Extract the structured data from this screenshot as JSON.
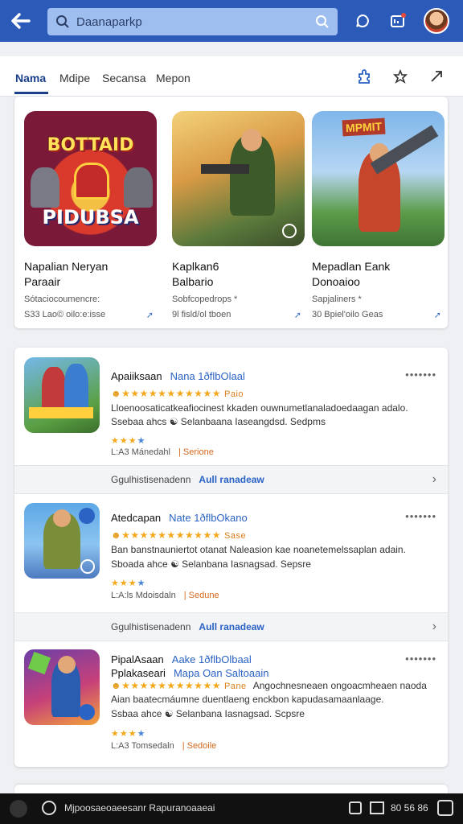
{
  "topbar": {
    "search_value": "Daanaparkp",
    "back_icon": "arrow-left-icon",
    "icons": [
      "search-icon",
      "chat-icon",
      "notifications-icon",
      "avatar"
    ]
  },
  "tabs": [
    {
      "label": "Nama",
      "active": true
    },
    {
      "label": "Mdipe",
      "active": false
    },
    {
      "label": "Secansa",
      "active": false
    },
    {
      "label": "Mepon",
      "active": false
    }
  ],
  "featured": [
    {
      "logo_top": "BOTTAID",
      "logo_bottom": "PIDUBSA",
      "title_l1": "Napalian Neryan",
      "title_l2": "Paraair",
      "sub": "Sótaciocoumencre:",
      "meta": "S33 Lao© oilo:e:isse"
    },
    {
      "title_l1": "Kaplkan6",
      "title_l2": "Balbario",
      "sub": "Sobfcopedrops *",
      "meta": "9l fisld/ol tboen"
    },
    {
      "logo_top": "MPMIT",
      "title_l1": "Mepadlan Eank",
      "title_l2": "Donoaioo",
      "sub": "Sapjaliners *",
      "meta": "30 Bpiel'oilo Geas"
    }
  ],
  "list": [
    {
      "name": "Apaiiksaan",
      "dev": "Nana 1ðflbOlaal",
      "more": "•••••••",
      "stars": "★★★★★★★★★★★",
      "rating": "Paio",
      "desc": "Lloenoosaticatkeafiocinest kkaden ouwnumetlanaladoedaagan adalo.",
      "line2": "Ssebaa ahcs  ☯  Selanbaana Iaseangdsd. Sedpms",
      "mini": "★★★",
      "mini_blue": "★",
      "meta": "L:A3 Mánedahl",
      "tag": "| Serione"
    },
    {
      "name": "Atedcapan",
      "dev": "Nate 1ðflbOkano",
      "more": "•••••••",
      "stars": "★★★★★★★★★★★",
      "rating": "Sase",
      "desc": "Ban banstnauniertot otanat Naleasion kae noanetemelssaplan adain.",
      "line2": "Sboada ahce  ☯  Selanbana Iasnagsad. Sepsre",
      "mini": "★★★",
      "mini_blue": "★",
      "meta": "L:A:ls Mdoisdaln",
      "tag": "| Sedune"
    },
    {
      "name": "PipalAsaan",
      "name2": "Pplakaseari",
      "dev": "Aake 1ðflbOlbaal",
      "dev2": "Mapa Oan Saltoaain",
      "more": "•••••••",
      "stars": "★★★★★★★★★★★",
      "rating": "Pane",
      "desc": "Angochnesneaen ongoacmheaen naoda",
      "desc2": "Aian baatecmáumne duentlaeng enckbon kapudasamaanlaage.",
      "line2": "Ssbaa ahce  ☯  Selanbana Iasnagsad. Scpsre",
      "mini": "★★★",
      "mini_blue": "★",
      "meta": "L:A3 Tomsedaln",
      "tag": "| Sedoile"
    }
  ],
  "expand_rows": [
    {
      "label": "Ggulhistisenadenn",
      "link": "Aull ranadeaw"
    },
    {
      "label": "Ggulhistisenadenn",
      "link": "Aull ranadeaw"
    }
  ],
  "bottombar": {
    "text": "Mjpoosaeoaeesanr Rapuranoaaeai",
    "counter": "80 56 86"
  },
  "colors": {
    "brand": "#2b5ab8",
    "accent": "#2a63c4",
    "star": "#f4a81c"
  }
}
